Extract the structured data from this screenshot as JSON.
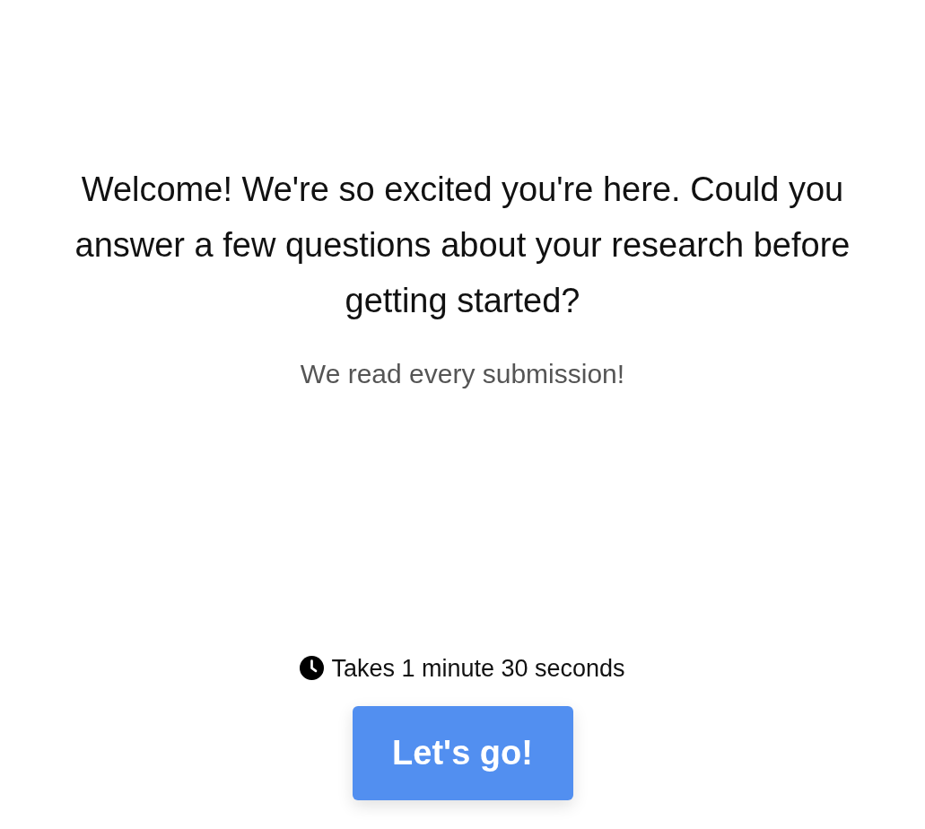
{
  "welcome": {
    "heading": "Welcome! We're so excited you're here. Could you answer a few questions about your research before getting started?",
    "subheading": "We read every submission!"
  },
  "duration": {
    "text": "Takes 1 minute 30 seconds"
  },
  "start_button": {
    "label": "Let's go!"
  }
}
